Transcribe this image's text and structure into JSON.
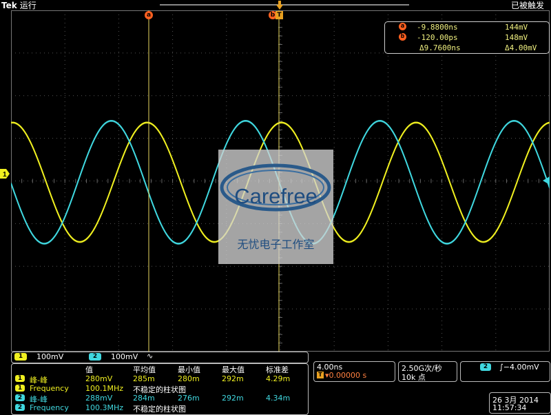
{
  "header": {
    "brand": "Tek",
    "run_state": "运行",
    "trigger_status": "已被触发"
  },
  "cursors": {
    "a_label": "a",
    "b_label": "b",
    "a_time": "-9.8800ns",
    "a_volt": "144mV",
    "b_time": "-120.00ps",
    "b_volt": "148mV",
    "delta_time": "Δ9.7600ns",
    "delta_volt": "Δ4.00mV"
  },
  "watermark": {
    "logo_text": "Carefree",
    "subtitle": "无忧电子工作室"
  },
  "channels": {
    "ch1_num": "1",
    "ch1_scale": "100mV",
    "ch2_num": "2",
    "ch2_scale": "100mV",
    "bw_symbol": "∿",
    "ch1_color": "#f0f020",
    "ch2_color": "#40d8e0"
  },
  "measurements": {
    "headers": [
      "值",
      "平均值",
      "最小值",
      "最大值",
      "标准差"
    ],
    "rows": [
      {
        "ch": "1",
        "name": "峰-峰",
        "value": "280mV",
        "mean": "285m",
        "min": "280m",
        "max": "292m",
        "std": "4.29m"
      },
      {
        "ch": "1",
        "name": "Frequency",
        "value": "100.1MHz",
        "mean": "不稳定的柱状图",
        "min": "",
        "max": "",
        "std": ""
      },
      {
        "ch": "2",
        "name": "峰-峰",
        "value": "288mV",
        "mean": "284m",
        "min": "276m",
        "max": "292m",
        "std": "4.34m"
      },
      {
        "ch": "2",
        "name": "Frequency",
        "value": "100.3MHz",
        "mean": "不稳定的柱状图",
        "min": "",
        "max": "",
        "std": ""
      }
    ]
  },
  "horizontal": {
    "scale": "4.00ns",
    "position": "▾0.00000 s",
    "trigger_glyph": "T"
  },
  "acquisition": {
    "rate": "2.50G次/秒",
    "points": "10k 点"
  },
  "trigger": {
    "source": "2",
    "level": "∫−4.00mV"
  },
  "datetime": {
    "date": "26 3月  2014",
    "time": "11:57:34"
  },
  "chart_data": {
    "type": "line",
    "x_unit": "ns",
    "xlim": [
      -20,
      20
    ],
    "ylim": [
      -400,
      400
    ],
    "divisions": {
      "x": 10,
      "y": 8
    },
    "series": [
      {
        "name": "1",
        "frequency_mhz": 100.1,
        "amplitude_mv": 140,
        "phase_deg": 0
      },
      {
        "name": "2",
        "frequency_mhz": 100.3,
        "amplitude_mv": 144,
        "phase_deg": 95
      }
    ]
  }
}
